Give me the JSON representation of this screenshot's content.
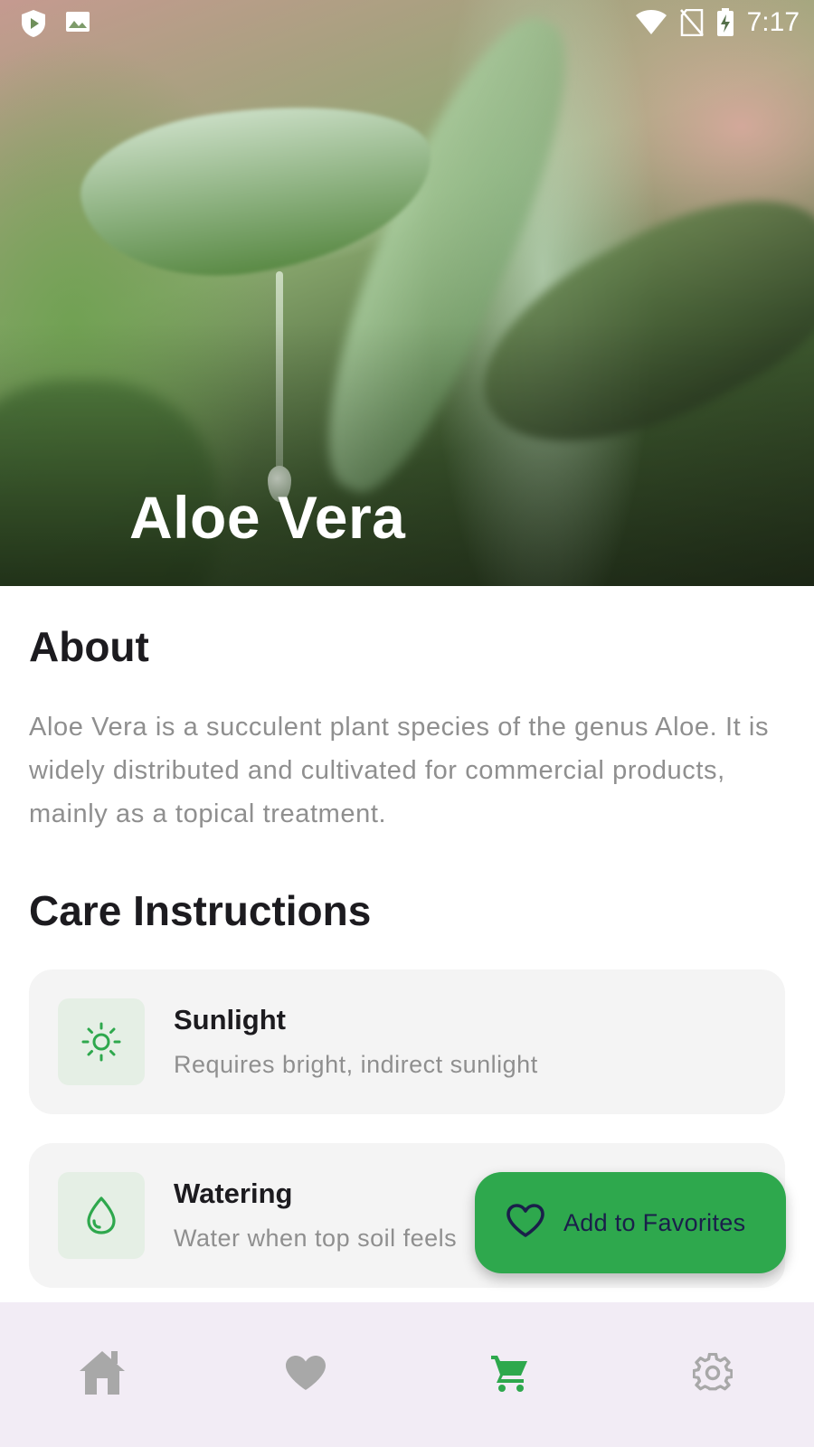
{
  "status_bar": {
    "time": "7:17",
    "icons": [
      "shield-play-icon",
      "image-icon",
      "wifi-icon",
      "no-sim-icon",
      "battery-charging-icon"
    ]
  },
  "hero": {
    "title": "Aloe Vera"
  },
  "about": {
    "heading": "About",
    "text": "Aloe Vera is a succulent plant species of the genus Aloe. It is widely distributed and cultivated for commercial products, mainly as a topical treatment."
  },
  "care": {
    "heading": "Care Instructions",
    "items": [
      {
        "title": "Sunlight",
        "description": "Requires bright, indirect sunlight",
        "icon": "sun-icon"
      },
      {
        "title": "Watering",
        "description": "Water when top soil feels",
        "icon": "water-drop-icon"
      }
    ]
  },
  "fab": {
    "label": "Add to Favorites",
    "icon": "heart-outline-icon"
  },
  "bottom_nav": {
    "items": [
      {
        "icon": "home-icon",
        "active": false
      },
      {
        "icon": "heart-icon",
        "active": false
      },
      {
        "icon": "cart-icon",
        "active": true
      },
      {
        "icon": "gear-icon",
        "active": false
      }
    ]
  },
  "colors": {
    "accent": "#2ea84d",
    "nav_inactive": "#a8a8a8",
    "nav_bg": "#f2ecf5",
    "card_bg": "#f4f4f4",
    "icon_box_bg": "#e5efe5"
  }
}
